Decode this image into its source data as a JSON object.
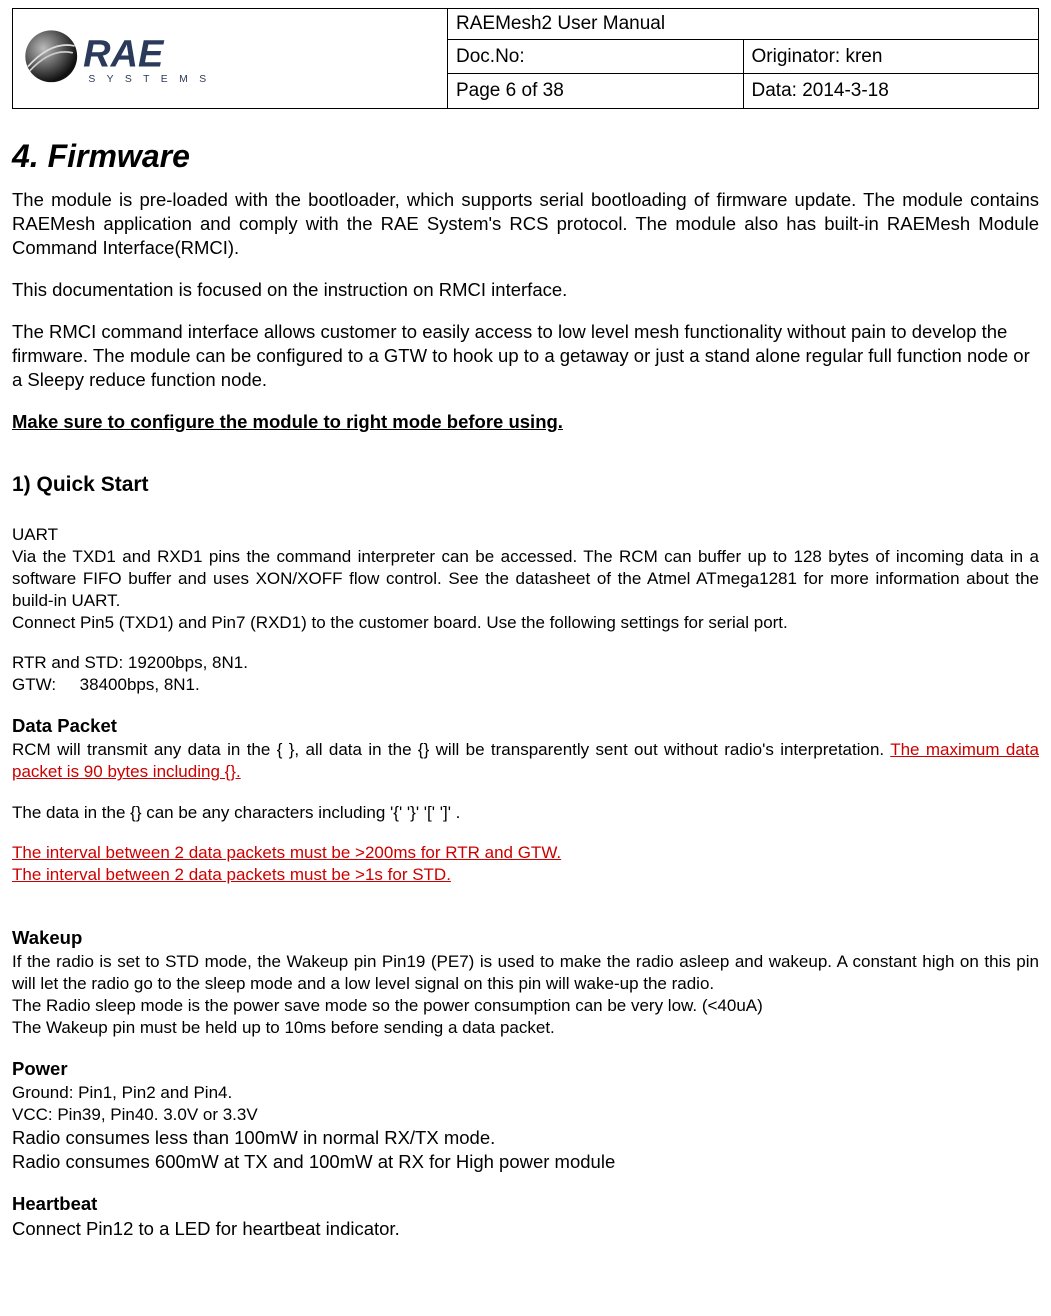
{
  "header": {
    "title": "RAEMesh2 User Manual",
    "docNoLabel": "Doc.No:",
    "docNoValue": "",
    "originator": "Originator: kren",
    "pageInfo": "Page 6 of 38",
    "dateInfo": "Data: 2014-3-18",
    "logoText": "RAE",
    "logoSub": "S Y S T E M S"
  },
  "section": {
    "heading": "4.   Firmware",
    "p1": "The module is pre-loaded with the bootloader, which supports serial bootloading of firmware update. The module contains RAEMesh application and comply with the RAE System's RCS protocol. The module also has built-in RAEMesh Module Command Interface(RMCI).",
    "p2": "This documentation is focused on the instruction on RMCI interface.",
    "p3": "The RMCI command interface allows customer to easily access to low level mesh functionality without pain to develop the firmware. The module can be configured to a GTW to hook up to a getaway or just a stand alone regular full function node or a Sleepy reduce function node.",
    "note": "Make sure to configure the module to right mode before using."
  },
  "quick": {
    "heading": "1) Quick Start",
    "uart": {
      "title": "UART",
      "p1": "Via the TXD1 and RXD1 pins the command interpreter can be accessed. The RCM can buffer up to 128 bytes of incoming data in a software FIFO buffer and uses XON/XOFF flow control. See the datasheet of the Atmel ATmega1281 for more information about the build-in UART.",
      "p2": "Connect Pin5 (TXD1) and Pin7 (RXD1) to the customer board. Use the following settings for serial port.",
      "p3": "RTR and STD: 19200bps, 8N1.",
      "p4": "GTW:     38400bps, 8N1."
    },
    "dataPacket": {
      "title": "Data Packet",
      "p1a": "RCM will transmit any data in the { }, all data in the {} will be transparently sent out without radio's interpretation. ",
      "p1b": "The maximum data packet is 90 bytes including {}.",
      "p2": "The data in the {} can be any characters including '{' '}' '[' ']' .",
      "p3": "The interval between 2 data packets must be >200ms for RTR and GTW.",
      "p4": "The interval between 2  data packets must be >1s for STD."
    },
    "wakeup": {
      "title": "Wakeup",
      "p1": "If the radio is set to STD mode, the Wakeup pin Pin19 (PE7) is used to make the radio asleep and wakeup.  A constant high on this pin will let the radio go to the sleep mode and a low level signal on this pin will wake-up the radio.",
      "p2": "The Radio sleep mode is the power save mode so the power consumption can be very low. (<40uA)",
      "p3": "The Wakeup pin must be held up to 10ms before sending a data packet."
    },
    "power": {
      "title": "Power",
      "p1": "Ground: Pin1, Pin2 and Pin4.",
      "p2": "VCC: Pin39, Pin40. 3.0V or 3.3V",
      "p3": "Radio consumes less than 100mW in normal RX/TX mode.",
      "p4": "Radio consumes 600mW at TX and 100mW at RX for High power module"
    },
    "heartbeat": {
      "title": "Heartbeat",
      "p1": "Connect Pin12 to a LED for heartbeat indicator."
    }
  }
}
